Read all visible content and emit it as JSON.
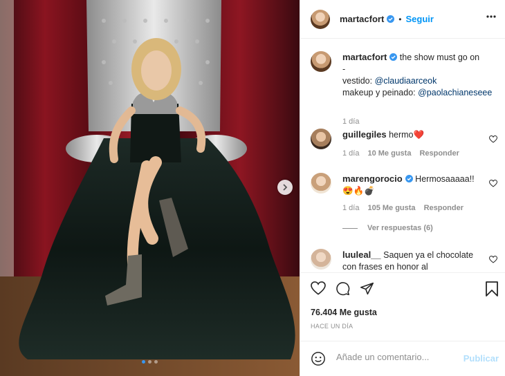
{
  "header": {
    "username": "martacfort",
    "follow_label": "Seguir",
    "bullet": "•"
  },
  "caption": {
    "username": "martacfort",
    "line1": "the show must go on",
    "line2": "-",
    "vestido_label": "vestido: ",
    "vestido_mention": "@claudiaarceok",
    "makeup_label": "makeup y peinado: ",
    "makeup_mention": "@paolachianeseee",
    "time": "1 día"
  },
  "comments": [
    {
      "username": "guillegiles",
      "text": "hermo❤️",
      "time": "1 día",
      "likes": "10 Me gusta",
      "reply": "Responder"
    },
    {
      "username": "marengorocio",
      "text": "Hermosaaaaa!! 😍🔥💣",
      "time": "1 día",
      "likes": "105 Me gusta",
      "reply": "Responder"
    },
    {
      "username": "luuleal__",
      "text": "Saquen ya el chocolate con frases en honor al"
    }
  ],
  "view_replies": "Ver respuestas (6)",
  "likes_count": "76.404 Me gusta",
  "posted_ago": "HACE UN DÍA",
  "comment_input": {
    "placeholder": "Añade un comentario..."
  },
  "publish_label": "Publicar",
  "carousel": {
    "total": 3,
    "current": 1
  },
  "colors": {
    "accent": "#0095f6",
    "mention": "#00376b",
    "publish_disabled": "#b2dffc",
    "verified": "#3897f0"
  }
}
